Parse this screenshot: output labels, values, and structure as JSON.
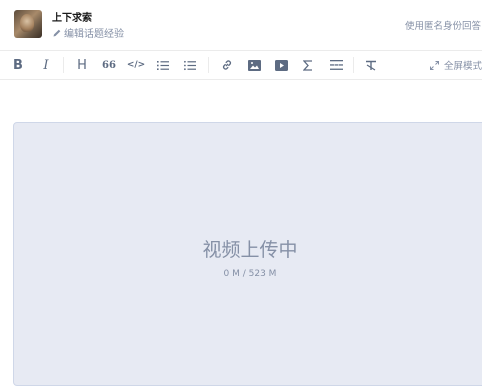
{
  "header": {
    "user_name": "上下求索",
    "edit_experience": "编辑话题经验",
    "anonymous_answer": "使用匿名身份回答"
  },
  "toolbar": {
    "bold": "B",
    "italic": "I",
    "heading": "H",
    "quote": "66",
    "code": "</>",
    "fullscreen": "全屏模式"
  },
  "upload": {
    "status": "视频上传中",
    "progress_text": "0 M / 523 M"
  },
  "colors": {
    "toolbar_icon": "#5d6b82",
    "muted_text": "#8590a6",
    "upload_bg": "#e7eaf3",
    "upload_border": "#cfd7e8"
  },
  "icons": [
    "pencil-icon",
    "bold-icon",
    "italic-icon",
    "heading-icon",
    "quote-icon",
    "code-icon",
    "ordered-list-icon",
    "bullet-list-icon",
    "link-icon",
    "image-icon",
    "video-icon",
    "formula-icon",
    "divider-icon",
    "clear-format-icon",
    "expand-icon"
  ]
}
